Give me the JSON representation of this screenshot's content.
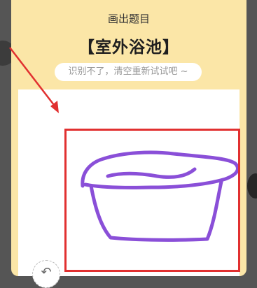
{
  "dialog": {
    "title": "画出题目",
    "word": "【室外浴池】",
    "hint": "识别不了，清空重新试试吧 ~"
  },
  "canvas": {
    "undo_icon": "undo-icon",
    "undo_glyph": "↶",
    "stroke_color": "#8a4fd8",
    "highlight_color": "#e13030"
  },
  "annotation": {
    "arrow_color": "#e13030"
  }
}
